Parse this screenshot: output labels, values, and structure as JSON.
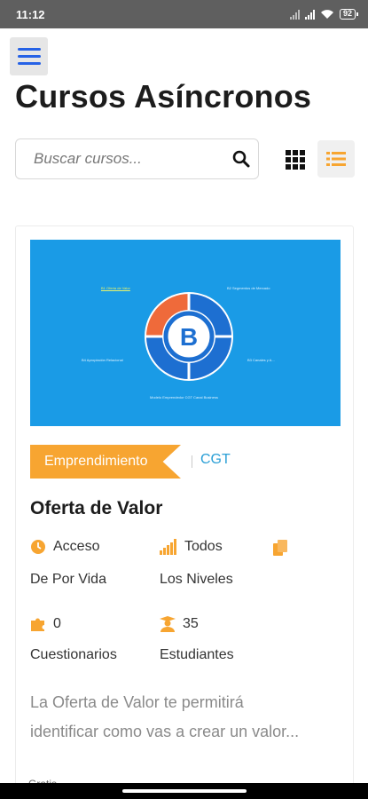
{
  "status_bar": {
    "time": "11:12",
    "battery": "92"
  },
  "header": {
    "title": "Cursos Asíncronos"
  },
  "search": {
    "placeholder": "Buscar cursos...",
    "value": ""
  },
  "view_toggle": {
    "grid_icon": "grid-icon",
    "list_icon": "list-icon",
    "active": "list"
  },
  "course": {
    "thumbnail": {
      "caption_top_left": "B1 Oferta de Valor",
      "caption_top_right": "B2 Segmentos de Mercado",
      "caption_mid_left": "B4 Apropiación Relacional",
      "caption_mid_right": "B3 Canales y A...",
      "caption_bottom": "Modelo Emprendedor CGT Canal Business"
    },
    "category": "Emprendimiento",
    "author": "CGT",
    "title": "Oferta de Valor",
    "access_label_1": "Acceso",
    "access_label_2": "De Por Vida",
    "level_label_1": "Todos",
    "level_label_2": "Los Niveles",
    "quizzes_count": "0",
    "quizzes_label": "Cuestionarios",
    "students_count": "35",
    "students_label": "Estudiantes",
    "description_line1": "La Oferta de Valor te permitirá",
    "description_line2": "identificar como vas a crear un valor...",
    "footer_peek": "Gratis"
  },
  "colors": {
    "accent": "#f7a531",
    "link": "#2a9fd6",
    "menu": "#2662e6",
    "thumbnail_bg": "#1a9be6"
  }
}
